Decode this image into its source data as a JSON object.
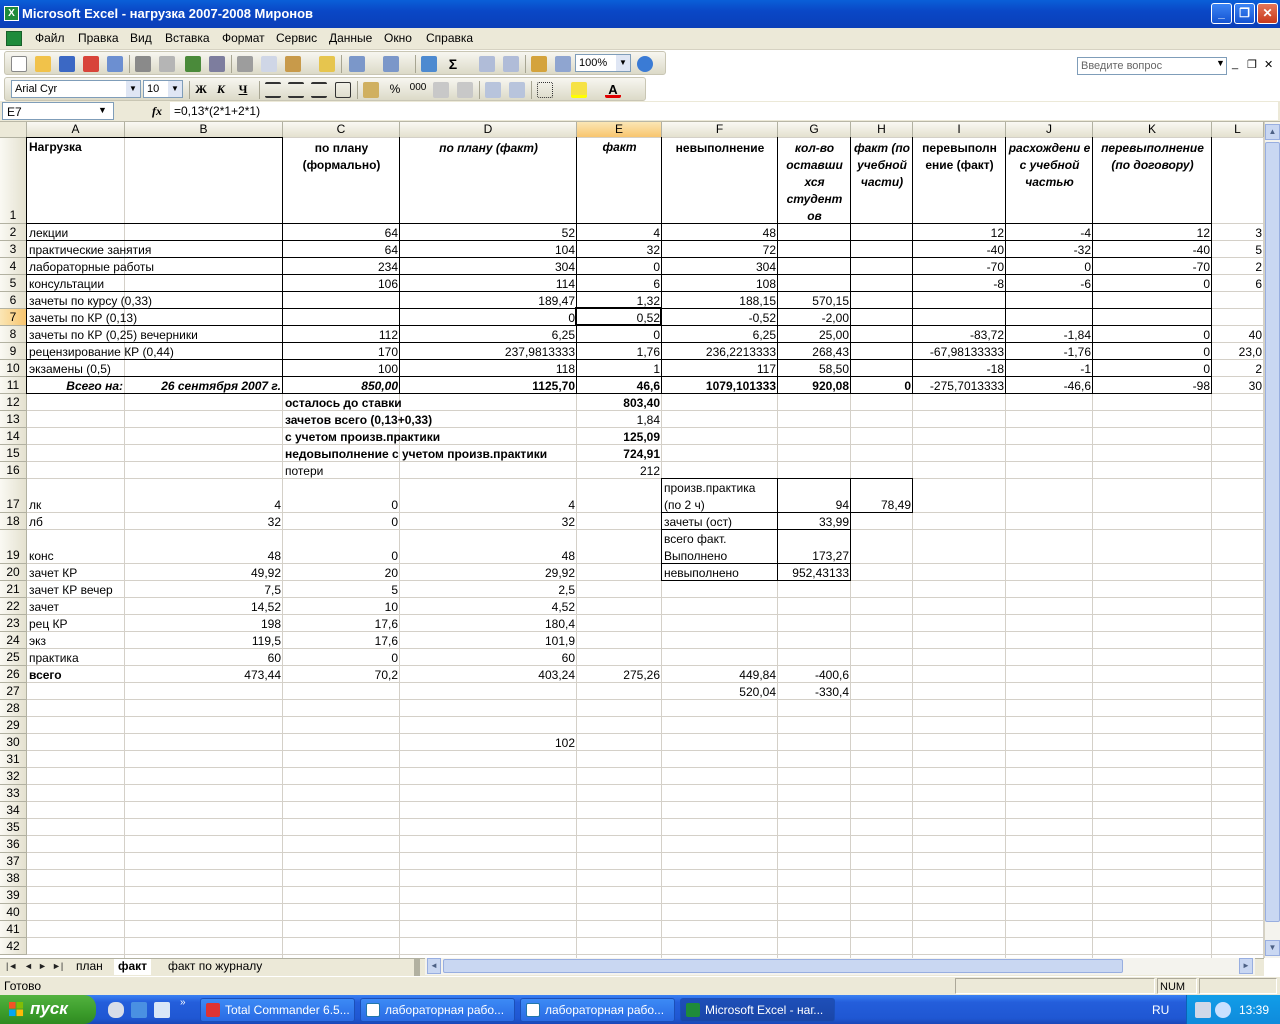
{
  "window": {
    "title": "Microsoft Excel - нагрузка 2007-2008 Миронов",
    "minimize": "_",
    "maximize": "❐",
    "close": "✕"
  },
  "menu": {
    "items": [
      "Файл",
      "Правка",
      "Вид",
      "Вставка",
      "Формат",
      "Сервис",
      "Данные",
      "Окно",
      "Справка"
    ],
    "help_placeholder": "Введите вопрос"
  },
  "toolbar": {
    "zoom": "100%",
    "font_name": "Arial Cyr",
    "font_size": "10",
    "bold": "Ж",
    "italic": "К",
    "underline": "Ч",
    "autosum": "Σ",
    "percent": "%",
    "thousands": "000"
  },
  "formula_bar": {
    "name_box": "E7",
    "fx": "fx",
    "formula": "=0,13*(2*1+2*1)"
  },
  "columns": [
    "A",
    "B",
    "C",
    "D",
    "E",
    "F",
    "G",
    "H",
    "I",
    "J",
    "K",
    "L"
  ],
  "selected_column": "E",
  "selected_row": "7",
  "rows": [
    "1",
    "2",
    "3",
    "4",
    "5",
    "6",
    "7",
    "8",
    "9",
    "10",
    "11",
    "12",
    "13",
    "14",
    "15",
    "16",
    "17",
    "18",
    "19",
    "20",
    "21",
    "22",
    "23",
    "24",
    "25",
    "26",
    "27",
    "28",
    "29",
    "30",
    "31",
    "32",
    "33",
    "34",
    "35",
    "36",
    "37",
    "38",
    "39",
    "40",
    "41",
    "42"
  ],
  "headers": {
    "a1": "Нагрузка",
    "c1": "по плану (формально)",
    "d1": "по плану (факт)",
    "e1": "факт",
    "f1": "невыполнение",
    "g1": "кол-во оставши хся студент ов",
    "h1": "факт (по учебной части)",
    "i1": "перевыполн ение (факт)",
    "j1": "расхождени е с учебной частью",
    "k1": "перевыполнение (по договору)"
  },
  "table": [
    {
      "a": "лекции",
      "c": "64",
      "d": "52",
      "e": "4",
      "f": "48",
      "g": "",
      "h": "",
      "i": "12",
      "j": "-4",
      "k": "12",
      "l": "3"
    },
    {
      "a": "практические занятия",
      "c": "64",
      "d": "104",
      "e": "32",
      "f": "72",
      "g": "",
      "h": "",
      "i": "-40",
      "j": "-32",
      "k": "-40",
      "l": "5"
    },
    {
      "a": "лабораторные работы",
      "c": "234",
      "d": "304",
      "e": "0",
      "f": "304",
      "g": "",
      "h": "",
      "i": "-70",
      "j": "0",
      "k": "-70",
      "l": "2"
    },
    {
      "a": "консультации",
      "c": "106",
      "d": "114",
      "e": "6",
      "f": "108",
      "g": "",
      "h": "",
      "i": "-8",
      "j": "-6",
      "k": "0",
      "l": "6"
    },
    {
      "a": "зачеты по курсу (0,33)",
      "c": "",
      "d": "189,47",
      "e": "1,32",
      "f": "188,15",
      "g": "570,15",
      "h": "",
      "i": "",
      "j": "",
      "k": "",
      "l": ""
    },
    {
      "a": "зачеты по КР (0,13)",
      "c": "",
      "d": "0",
      "e": "0,52",
      "f": "-0,52",
      "g": "-2,00",
      "h": "",
      "i": "",
      "j": "",
      "k": "",
      "l": ""
    },
    {
      "a": "зачеты по КР (0,25) вечерники",
      "c": "112",
      "d": "6,25",
      "e": "0",
      "f": "6,25",
      "g": "25,00",
      "h": "",
      "i": "-83,72",
      "j": "-1,84",
      "k": "0",
      "l": "40"
    },
    {
      "a": "рецензирование КР (0,44)",
      "c": "170",
      "d": "237,9813333",
      "e": "1,76",
      "f": "236,2213333",
      "g": "268,43",
      "h": "",
      "i": "-67,98133333",
      "j": "-1,76",
      "k": "0",
      "l": "23,0"
    },
    {
      "a": "экзамены (0,5)",
      "c": "100",
      "d": "118",
      "e": "1",
      "f": "117",
      "g": "58,50",
      "h": "",
      "i": "-18",
      "j": "-1",
      "k": "0",
      "l": "2"
    },
    {
      "a": "Всего на:",
      "b": "26 сентября 2007 г.",
      "c": "850,00",
      "d": "1125,70",
      "e": "46,6",
      "f": "1079,101333",
      "g": "920,08",
      "h": "0",
      "i": "-275,7013333",
      "j": "-46,6",
      "k": "-98",
      "l": "30"
    }
  ],
  "summary": [
    {
      "label": "осталось до ставки",
      "value": "803,40"
    },
    {
      "label": "зачетов всего (0,13+0,33)",
      "value": "1,84"
    },
    {
      "label": "с учетом произв.практики",
      "value": "125,09"
    },
    {
      "label": "недовыполнение с учетом произв.практики",
      "value": "724,91"
    },
    {
      "label": "потери",
      "value": "212"
    }
  ],
  "side": {
    "f17a": "произв.практика",
    "f17b": "(по 2 ч)",
    "g17": "94",
    "h17": "78,49",
    "f18": "зачеты (ост)",
    "g18": "33,99",
    "f19a": "всего факт.",
    "f19b": "Выполнено",
    "g19": "173,27",
    "f20": "невыполнено",
    "g20": "952,43133"
  },
  "lower": [
    {
      "a": "лк",
      "b": "4",
      "c": "0",
      "d": "4"
    },
    {
      "a": "лб",
      "b": "32",
      "c": "0",
      "d": "32"
    },
    {
      "a": "конс",
      "b": "48",
      "c": "0",
      "d": "48"
    },
    {
      "a": "зачет КР",
      "b": "49,92",
      "c": "20",
      "d": "29,92"
    },
    {
      "a": "зачет КР вечер",
      "b": "7,5",
      "c": "5",
      "d": "2,5"
    },
    {
      "a": "зачет",
      "b": "14,52",
      "c": "10",
      "d": "4,52"
    },
    {
      "a": "рец КР",
      "b": "198",
      "c": "17,6",
      "d": "180,4"
    },
    {
      "a": "экз",
      "b": "119,5",
      "c": "17,6",
      "d": "101,9"
    },
    {
      "a": "практика",
      "b": "60",
      "c": "0",
      "d": "60"
    },
    {
      "a": "всего",
      "b": "473,44",
      "c": "70,2",
      "d": "403,24",
      "e": "275,26",
      "f": "449,84",
      "g": "-400,6"
    }
  ],
  "row27": {
    "f": "520,04",
    "g": "-330,4"
  },
  "row30": {
    "d": "102"
  },
  "sheets": [
    "план",
    "факт",
    "факт по журналу"
  ],
  "active_sheet": "факт",
  "status": {
    "ready": "Готово",
    "num": "NUM"
  },
  "taskbar": {
    "start": "пуск",
    "tasks": [
      "Total Commander 6.5...",
      "лабораторная рабо...",
      "лабораторная рабо...",
      "Microsoft Excel - наг..."
    ],
    "lang": "RU",
    "time": "13:39"
  }
}
